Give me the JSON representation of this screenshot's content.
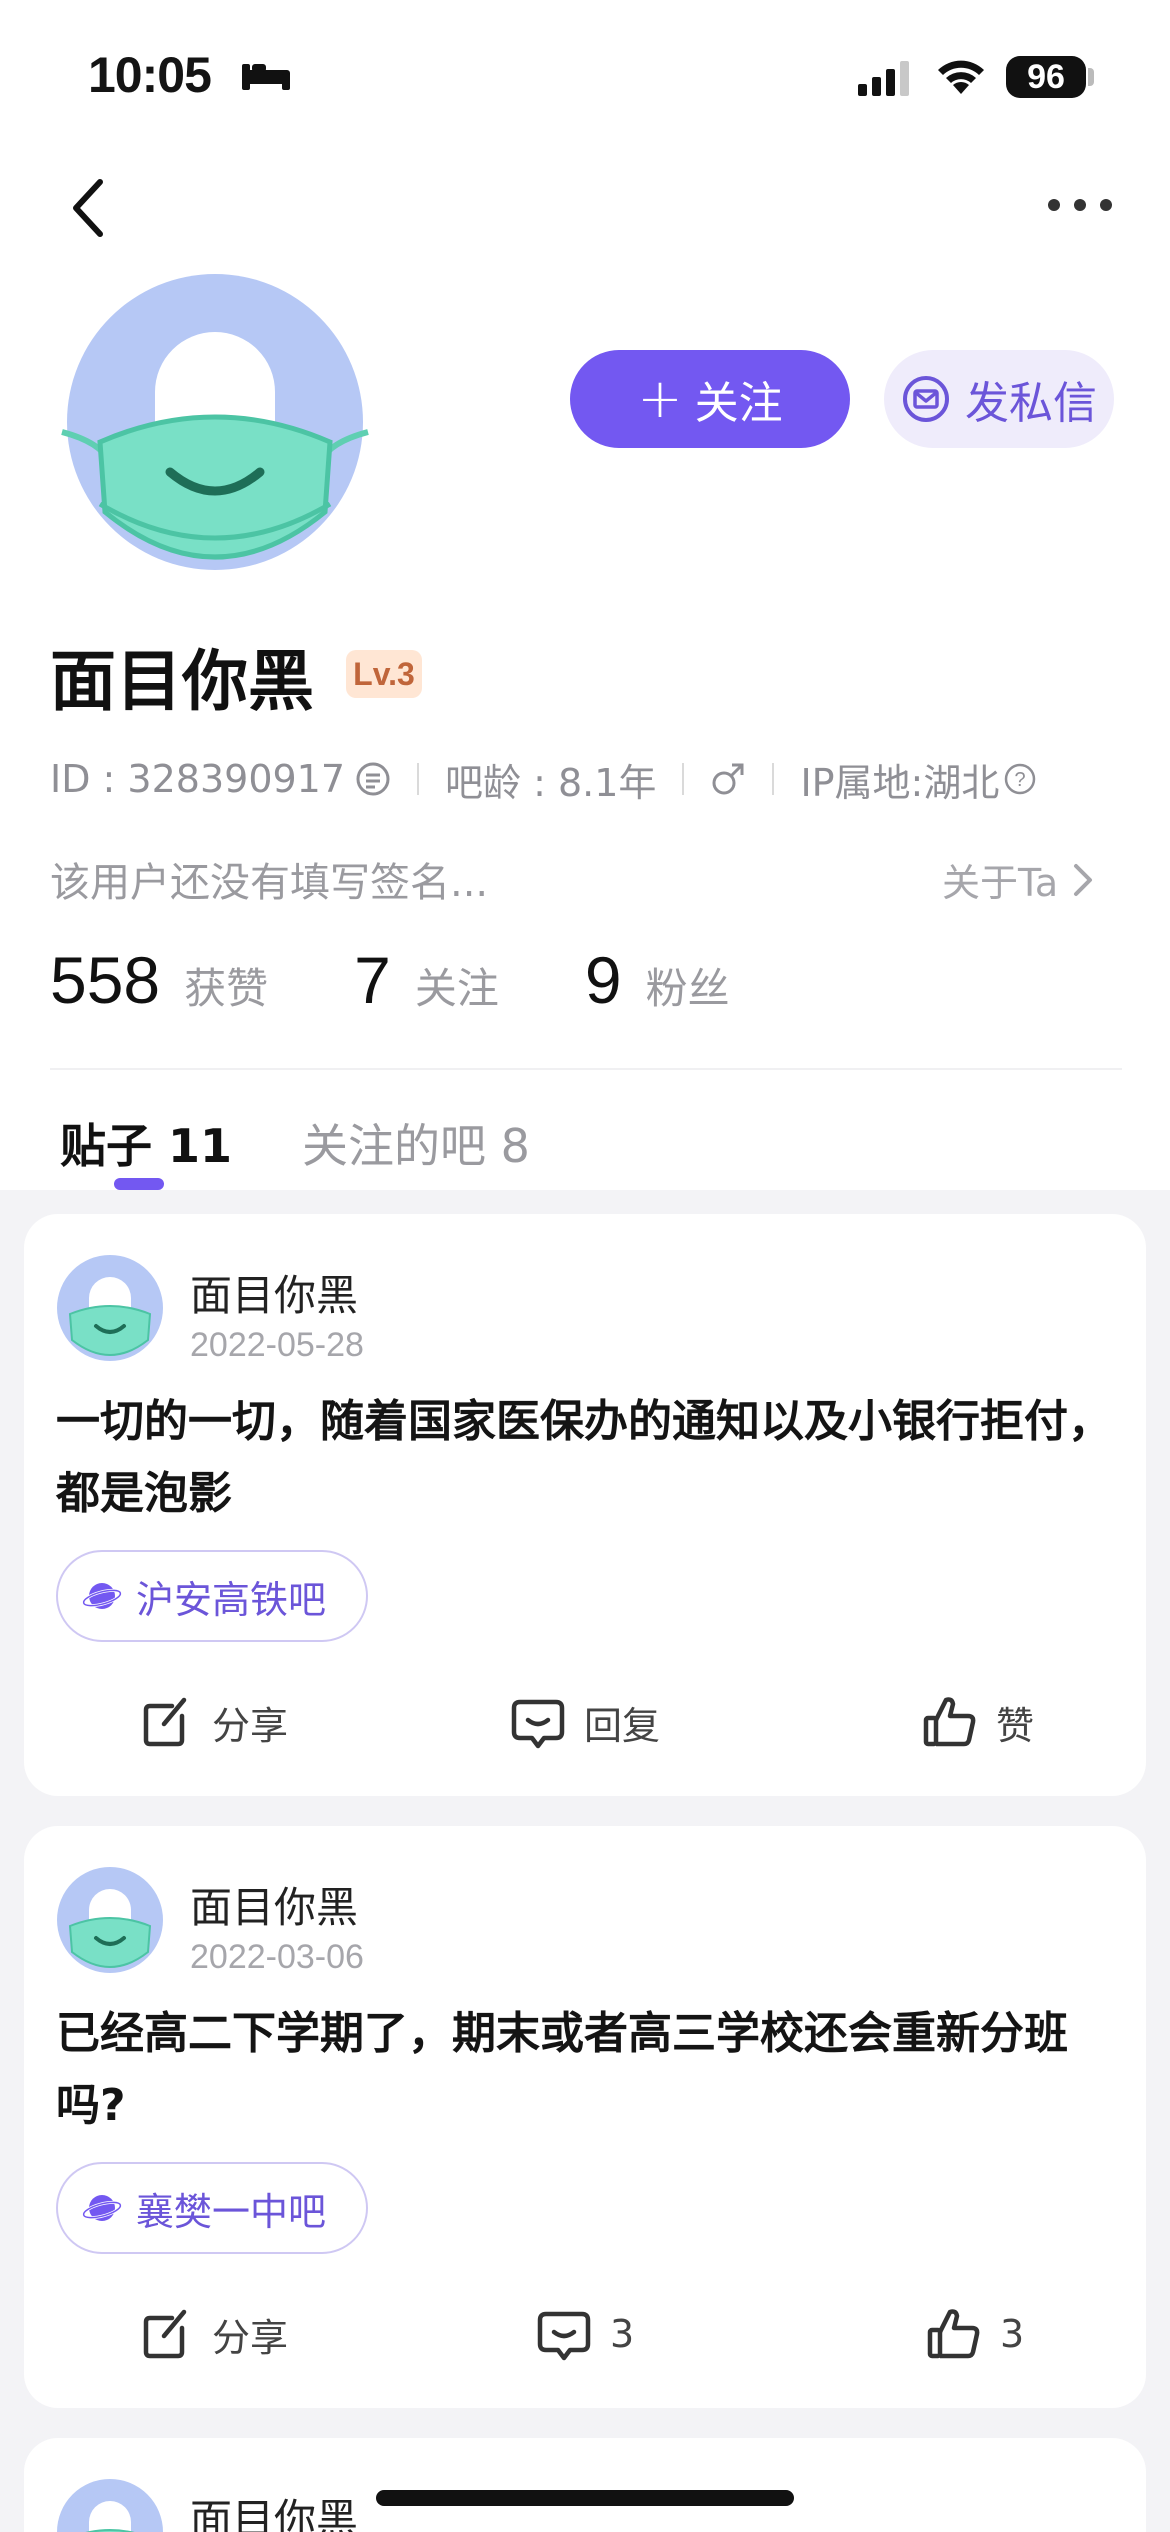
{
  "status_bar": {
    "time": "10:05",
    "battery": "96"
  },
  "profile": {
    "follow_label": "关注",
    "dm_label": "发私信",
    "username": "面目你黑",
    "level": "Lv.3",
    "id_text": "ID : 328390917",
    "age_text": "吧龄 : 8.1年",
    "ip_text": "IP属地:湖北",
    "signature": "该用户还没有填写签名...",
    "about_label": "关于Ta"
  },
  "stats": [
    {
      "num": "558",
      "label": "获赞"
    },
    {
      "num": "7",
      "label": "关注"
    },
    {
      "num": "9",
      "label": "粉丝"
    }
  ],
  "tabs": [
    {
      "label": "贴子 11",
      "active": true
    },
    {
      "label": "关注的吧 8",
      "active": false
    }
  ],
  "posts": [
    {
      "author": "面目你黑",
      "date": "2022-05-28",
      "text": "一切的一切，随着国家医保办的通知以及小银行拒付，都是泡影",
      "forum": "沪安高铁吧",
      "share": "分享",
      "reply": "回复",
      "like": "赞"
    },
    {
      "author": "面目你黑",
      "date": "2022-03-06",
      "text": "已经高二下学期了，期末或者高三学校还会重新分班吗?",
      "forum": "襄樊一中吧",
      "share": "分享",
      "reply": "3",
      "like": "3"
    },
    {
      "author": "面目你黑"
    }
  ],
  "colors": {
    "accent": "#7358F1",
    "accent_light": "#EFECFB",
    "avatar_bg": "#B6C8F5",
    "mask": "#79E0C6"
  }
}
